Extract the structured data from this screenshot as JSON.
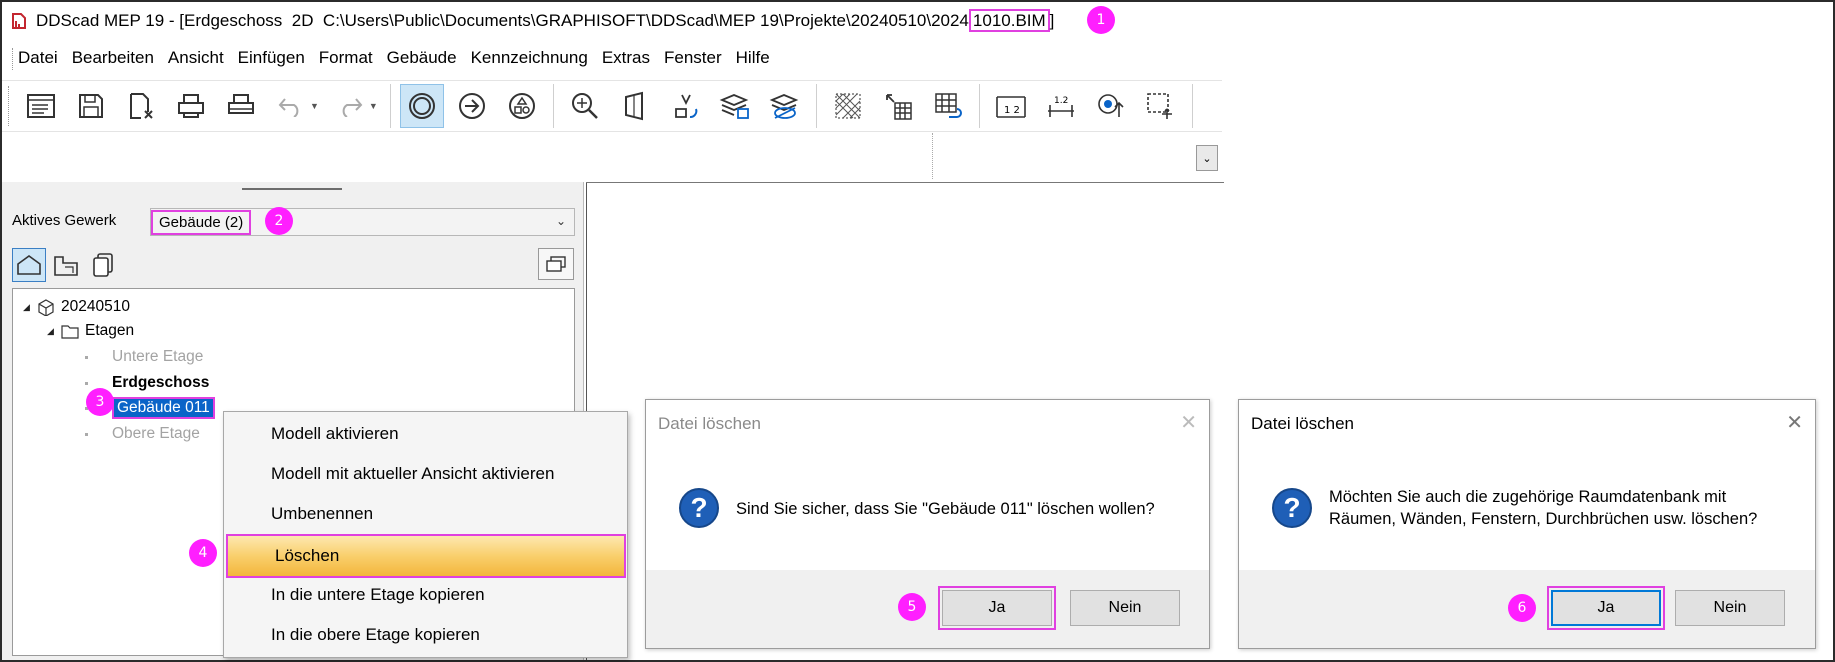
{
  "window": {
    "title_prefix": "DDScad MEP 19 - [Erdgeschoss  2D  C:\\Users\\Public\\Documents\\GRAPHISOFT\\DDScad\\MEP 19\\Projekte\\20240510\\2024",
    "title_highlight": "1010.BIM",
    "title_suffix": "]"
  },
  "menu": [
    "Datei",
    "Bearbeiten",
    "Ansicht",
    "Einfügen",
    "Format",
    "Gebäude",
    "Kennzeichnung",
    "Extras",
    "Fenster",
    "Hilfe"
  ],
  "toolbar": {
    "icons": [
      "properties-icon",
      "save-icon",
      "close-file-icon",
      "print-preview-icon",
      "print-icon",
      "undo-icon",
      "redo-icon",
      "circle-select-icon",
      "arrow-right-icon",
      "shapes-icon",
      "zoom-icon",
      "view-3d-icon",
      "rotate-icon",
      "layers-icon",
      "layers-hide-icon",
      "grid-hatch-icon",
      "grid-move-icon",
      "grid-rotate-icon",
      "dimension-icon",
      "dimension-horizontal-icon",
      "snap-point-icon",
      "select-box-icon"
    ]
  },
  "left_panel": {
    "label_gewerk": "Aktives Gewerk",
    "combo_value": "Gebäude (2)",
    "tree": {
      "root": "20240510",
      "etagen": "Etagen",
      "untere": "Untere Etage",
      "erdgeschoss": "Erdgeschoss",
      "selected": "Gebäude 011",
      "obere": "Obere Etage"
    }
  },
  "context_menu": {
    "items": [
      "Modell aktivieren",
      "Modell mit aktueller Ansicht aktivieren",
      "Umbenennen",
      "Löschen",
      "In die untere Etage kopieren",
      "In die obere Etage kopieren"
    ]
  },
  "dialog1": {
    "title": "Datei löschen",
    "message": "Sind Sie sicher, dass Sie \"Gebäude 011\" löschen wollen?",
    "yes": "Ja",
    "no": "Nein"
  },
  "dialog2": {
    "title": "Datei löschen",
    "message_line1": "Möchten Sie auch die zugehörige Raumdatenbank mit",
    "message_line2": "Räumen, Wänden, Fenstern, Durchbrüchen usw. löschen?",
    "yes": "Ja",
    "no": "Nein"
  },
  "badges": [
    "1",
    "2",
    "3",
    "4",
    "5",
    "6"
  ],
  "colors": {
    "badge": "#ff1fff",
    "highlight_border": "#e040e0",
    "selection": "#0a64c8",
    "question_icon": "#1f5fb7"
  }
}
